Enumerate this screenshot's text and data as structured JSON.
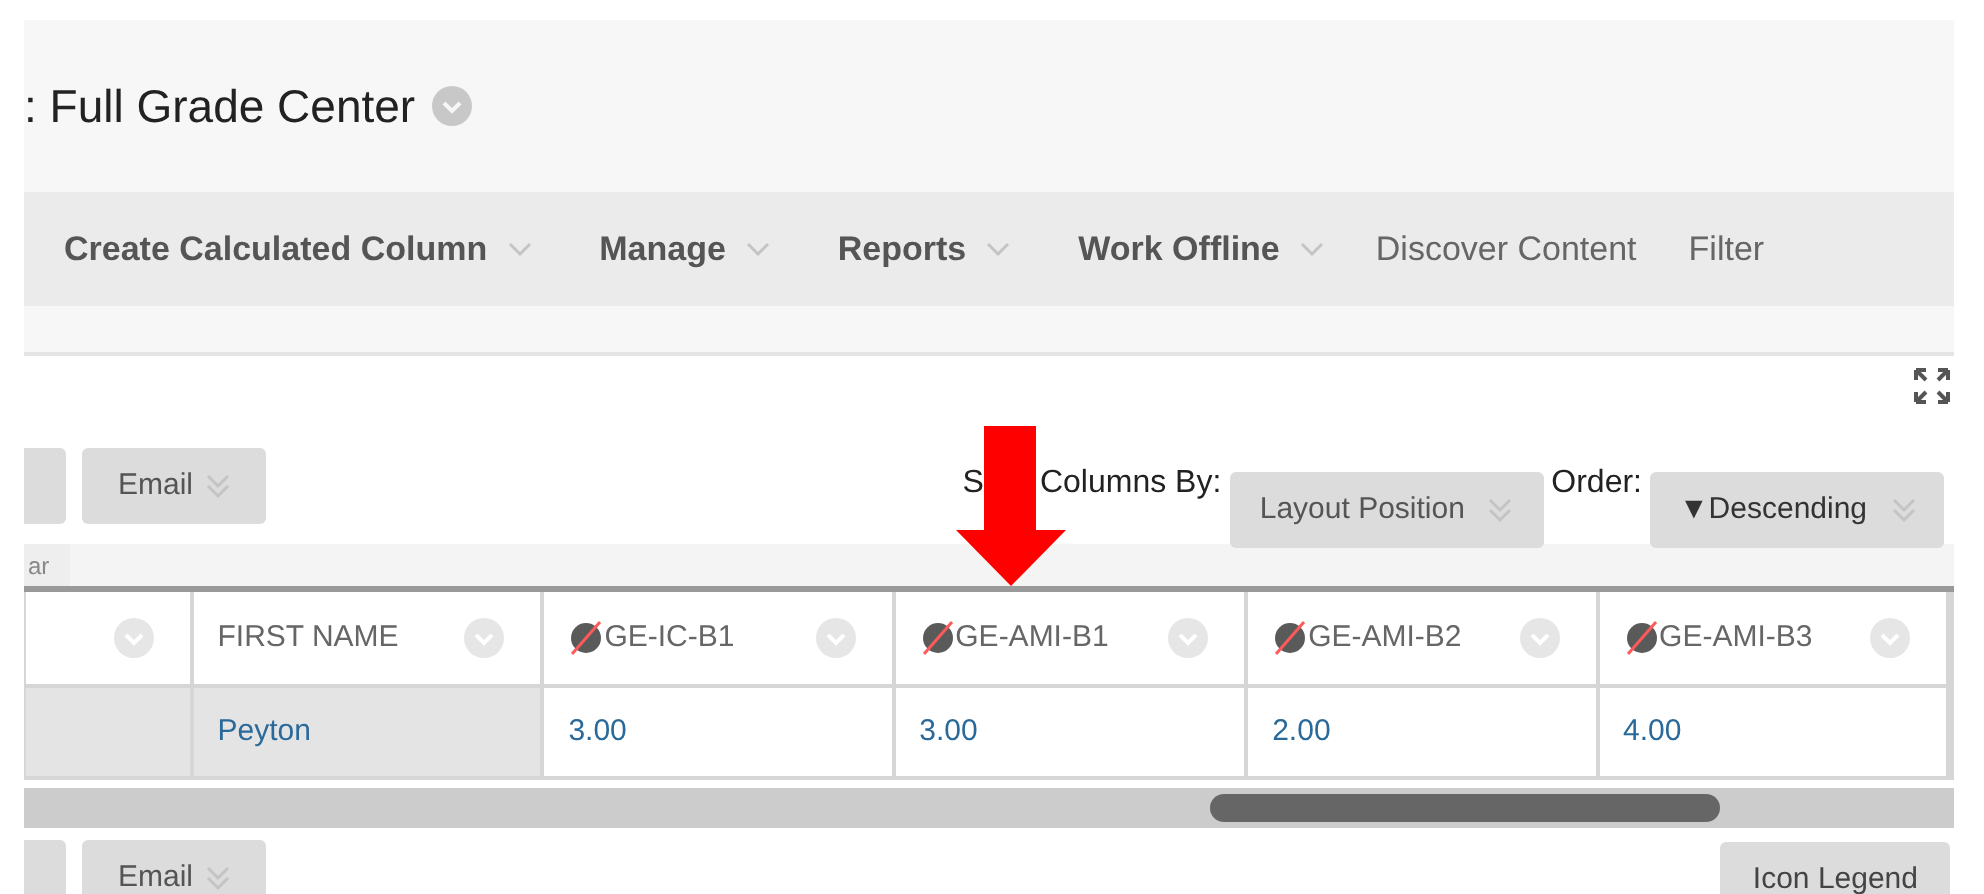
{
  "page_title": ": Full Grade Center",
  "menu": [
    {
      "label": "Create Calculated Column",
      "kind": "dropdown"
    },
    {
      "label": "Manage",
      "kind": "dropdown"
    },
    {
      "label": "Reports",
      "kind": "dropdown"
    },
    {
      "label": "Work Offline",
      "kind": "dropdown"
    },
    {
      "label": "Discover Content",
      "kind": "link"
    },
    {
      "label": "Filter",
      "kind": "link"
    }
  ],
  "top_buttons": [
    {
      "label": "Email"
    }
  ],
  "sort": {
    "label_start": "S",
    "label_end": "Columns By:",
    "value": "Layout Position"
  },
  "order": {
    "label": "Order:",
    "value": "▼Descending"
  },
  "filter_tab": "ar",
  "columns": [
    {
      "label": "FIRST NAME",
      "kind": "text"
    },
    {
      "label": "GE-IC-B1",
      "kind": "hidden"
    },
    {
      "label": "GE-AMI-B1",
      "kind": "hidden"
    },
    {
      "label": "GE-AMI-B2",
      "kind": "hidden"
    },
    {
      "label": "GE-AMI-B3",
      "kind": "hidden"
    }
  ],
  "rows": [
    {
      "cells": [
        "Peyton",
        "3.00",
        "3.00",
        "2.00",
        "4.00"
      ]
    }
  ],
  "bottom_buttons": [
    {
      "label": "Email"
    }
  ],
  "icon_legend": "Icon Legend"
}
